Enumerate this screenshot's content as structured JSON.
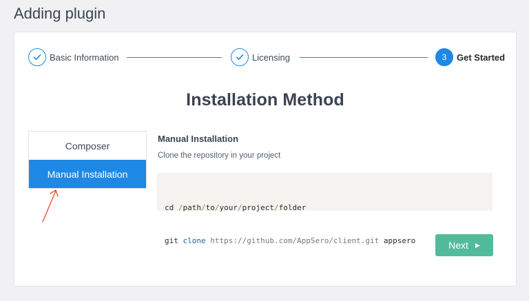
{
  "page": {
    "title": "Adding plugin"
  },
  "stepper": {
    "steps": [
      {
        "label": "Basic Information",
        "state": "completed"
      },
      {
        "label": "Licensing",
        "state": "completed"
      },
      {
        "label": "Get Started",
        "number": "3",
        "state": "active"
      }
    ],
    "accent_color": "#1e88e5"
  },
  "install": {
    "title": "Installation Method",
    "methods": [
      {
        "label": "Composer",
        "selected": false
      },
      {
        "label": "Manual Installation",
        "selected": true
      }
    ],
    "heading": "Manual Installation",
    "description": "Clone the repository in your project",
    "code_lines": [
      "cd /path/to/your/project/folder",
      "git clone https://github.com/AppSero/client.git appsero"
    ]
  },
  "actions": {
    "next_label": "Next",
    "next_color": "#52bc9a"
  },
  "annotation": {
    "arrow_color": "#e8553a"
  }
}
